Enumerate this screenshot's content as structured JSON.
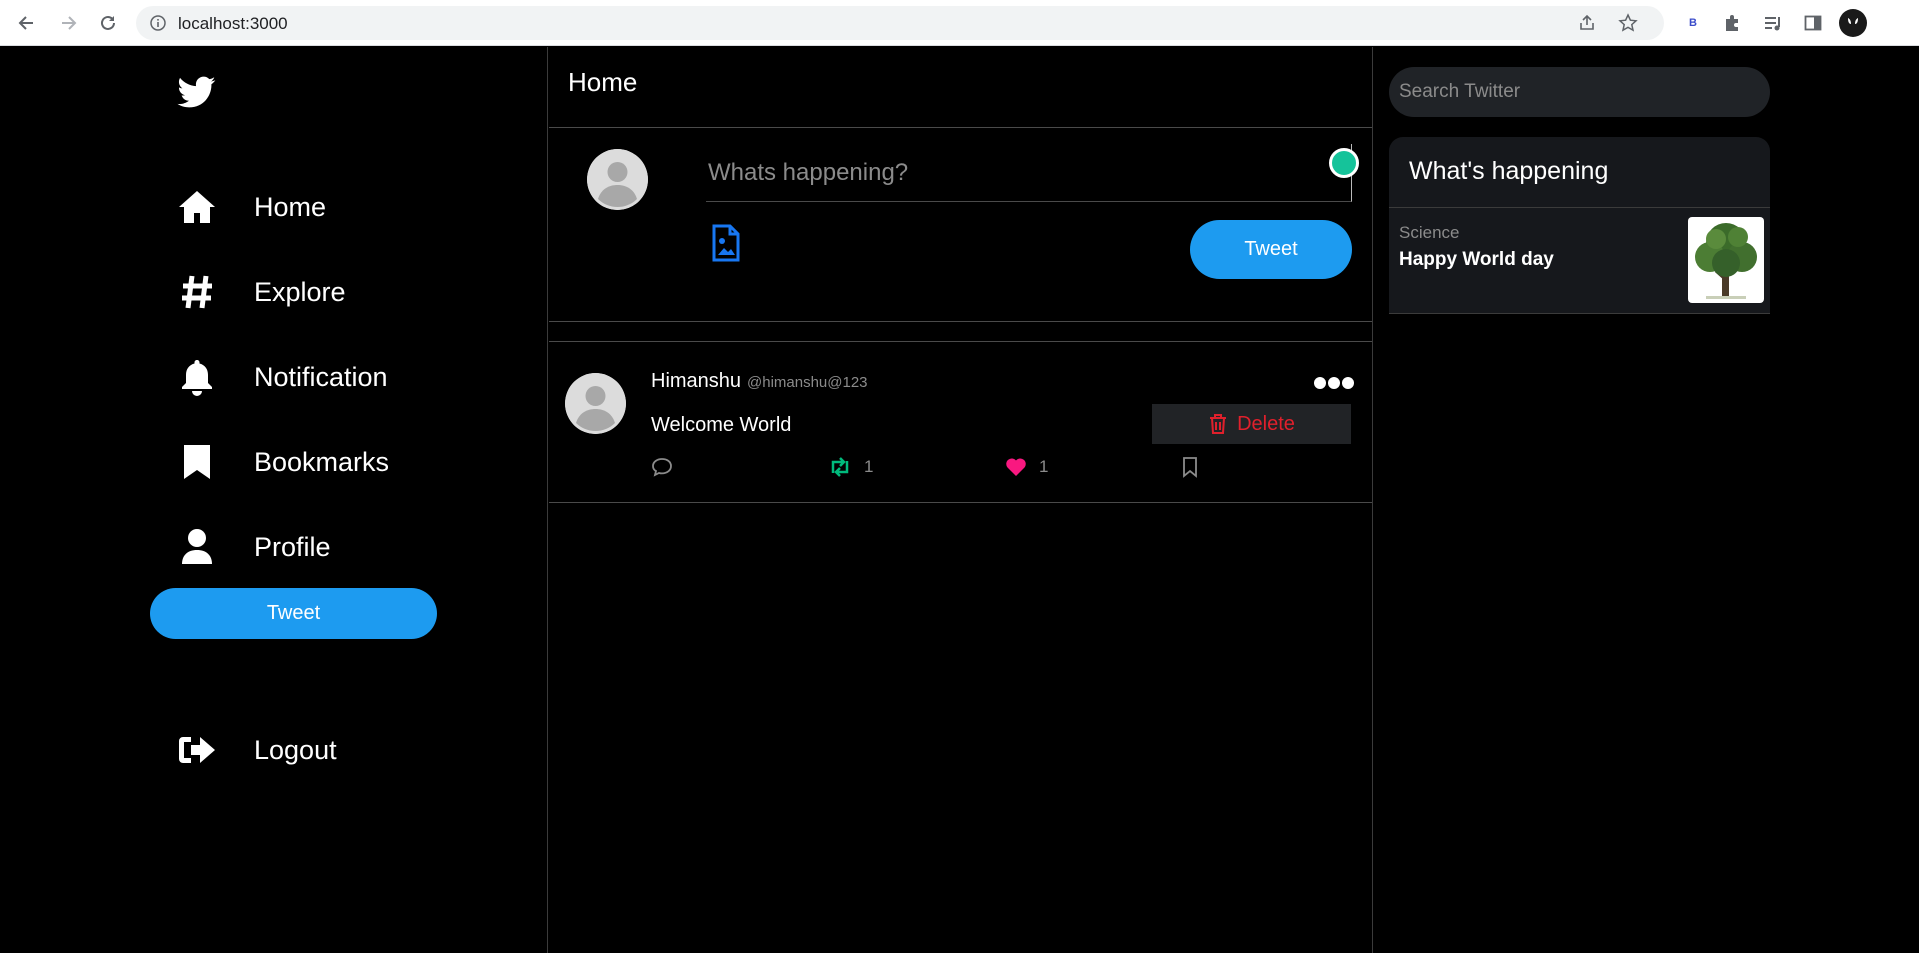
{
  "browser": {
    "url": "localhost:3000"
  },
  "sidebar": {
    "items": [
      {
        "label": "Home",
        "icon": "home-icon"
      },
      {
        "label": "Explore",
        "icon": "hashtag-icon"
      },
      {
        "label": "Notification",
        "icon": "bell-icon"
      },
      {
        "label": "Bookmarks",
        "icon": "bookmark-icon"
      },
      {
        "label": "Profile",
        "icon": "user-icon"
      }
    ],
    "tweet_button": "Tweet",
    "logout_label": "Logout"
  },
  "main": {
    "title": "Home",
    "compose": {
      "placeholder": "Whats happening?",
      "tweet_button": "Tweet"
    },
    "posts": [
      {
        "name": "Himanshu",
        "handle": "@himanshu@123",
        "text": "Welcome World",
        "delete_label": "Delete",
        "retweets": "1",
        "likes": "1"
      }
    ]
  },
  "right": {
    "search_placeholder": "Search Twitter",
    "trends_title": "What's happening",
    "trends": [
      {
        "category": "Science",
        "title": "Happy World day"
      }
    ]
  },
  "colors": {
    "accent": "#1d9bf0",
    "delete": "#e0202c",
    "retweet": "#00ba7c",
    "like": "#f91880"
  }
}
